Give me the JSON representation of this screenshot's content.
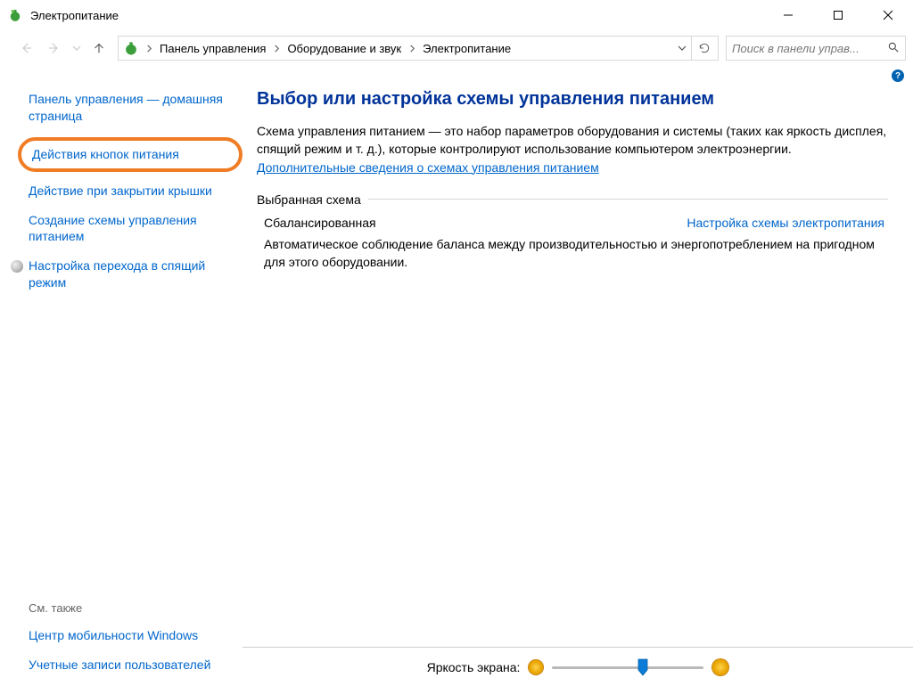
{
  "window": {
    "title": "Электропитание"
  },
  "breadcrumb": {
    "items": [
      "Панель управления",
      "Оборудование и звук",
      "Электропитание"
    ]
  },
  "search": {
    "placeholder": "Поиск в панели управ..."
  },
  "sidebar": {
    "home": "Панель управления — домашняя страница",
    "items": [
      "Действия кнопок питания",
      "Действие при закрытии крышки",
      "Создание схемы управления питанием",
      "Настройка перехода в спящий режим"
    ],
    "see_also_title": "См. также",
    "see_also": [
      "Центр мобильности Windows",
      "Учетные записи пользователей"
    ]
  },
  "main": {
    "title": "Выбор или настройка схемы управления питанием",
    "desc_prefix": "Схема управления питанием — это набор параметров оборудования и системы (таких как яркость дисплея, спящий режим и т. д.), которые контролируют использование компьютером электроэнергии. ",
    "desc_link": "Дополнительные сведения о схемах управления питанием",
    "selected_section": "Выбранная схема",
    "plan_name": "Сбалансированная",
    "plan_link": "Настройка схемы электропитания",
    "plan_desc": "Автоматическое соблюдение баланса между производительностью и энергопотреблением на пригодном для этого оборудовании."
  },
  "brightness": {
    "label": "Яркость экрана:"
  }
}
